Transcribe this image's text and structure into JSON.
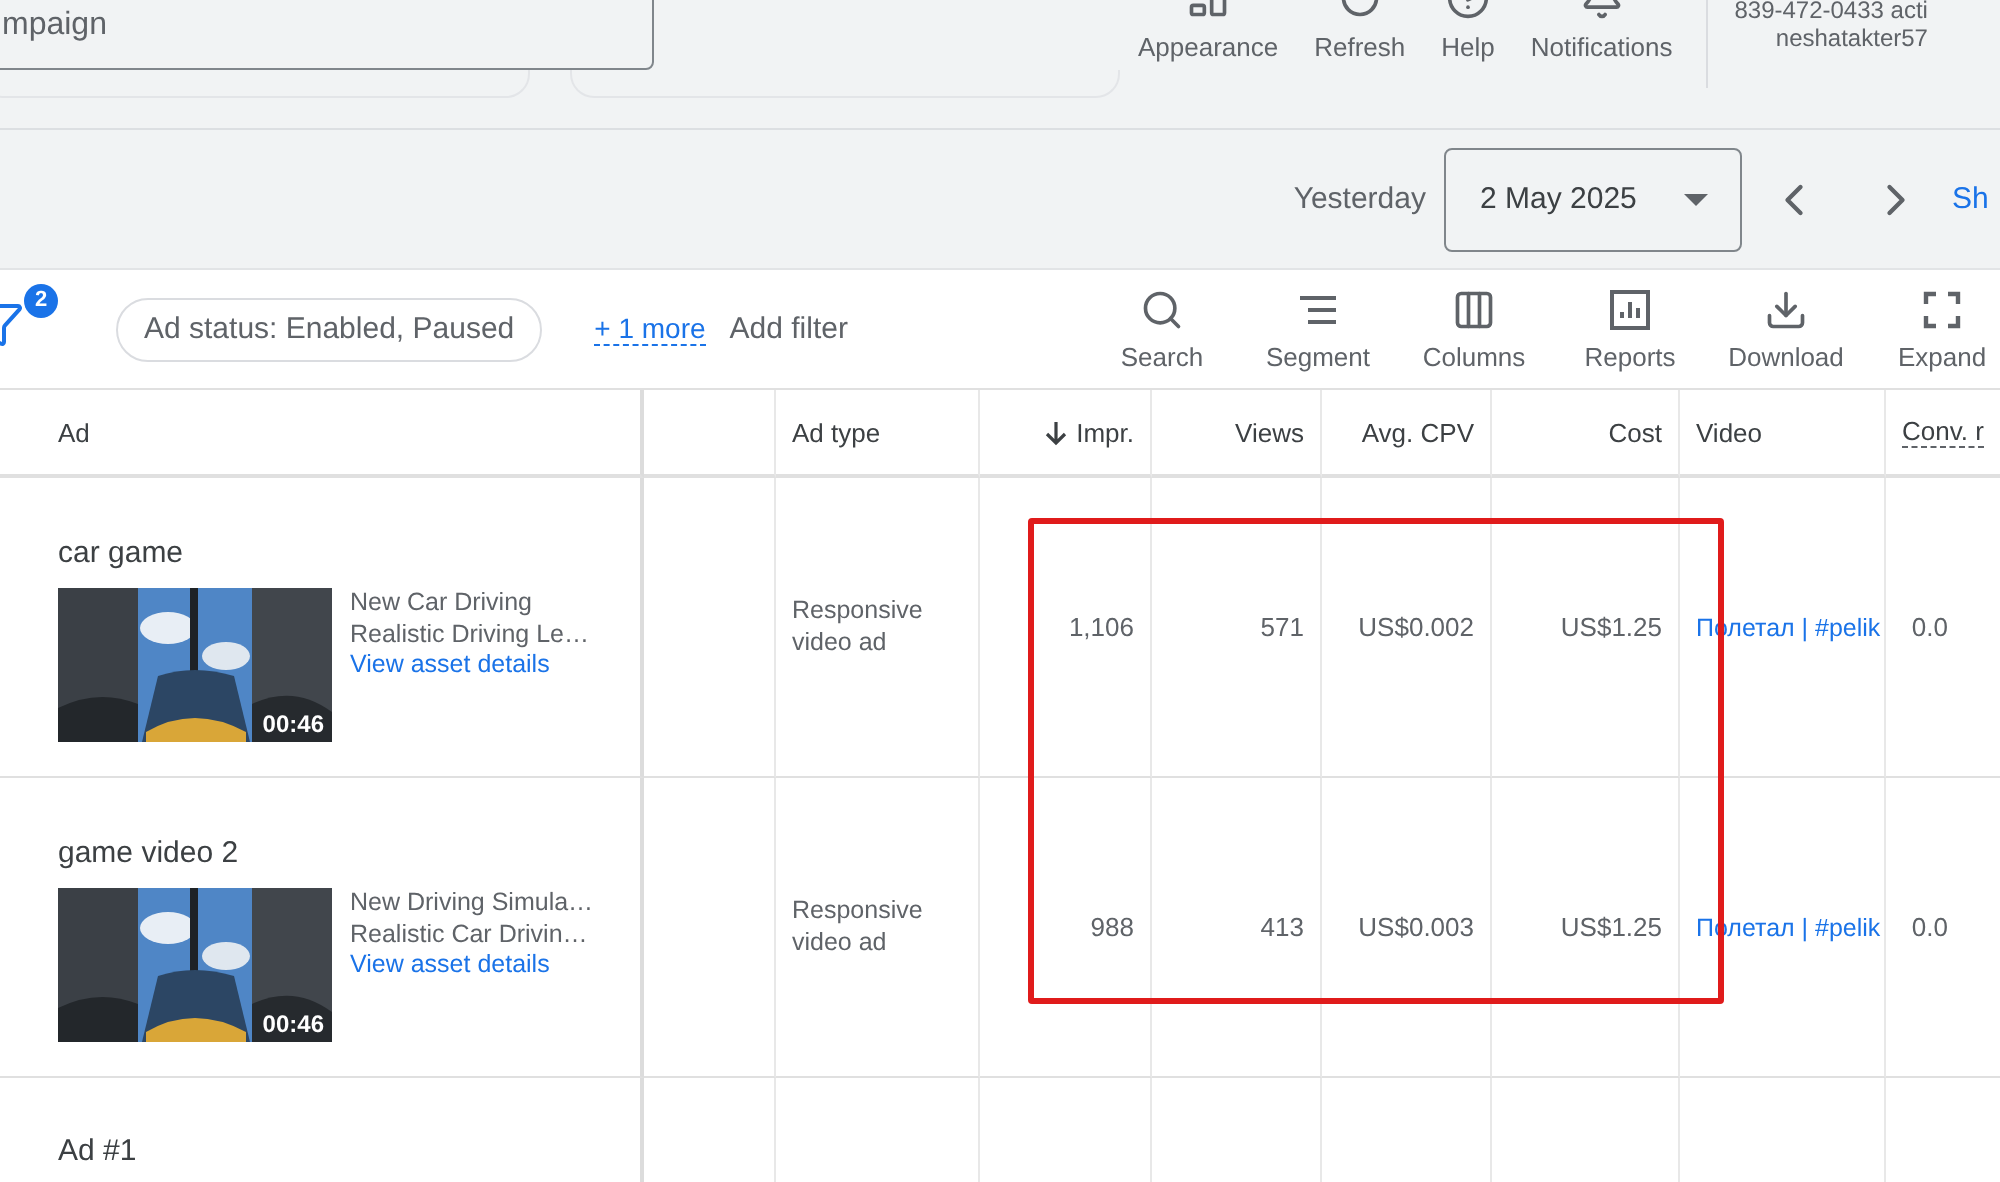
{
  "header": {
    "search_value": "mpaign",
    "tools": [
      {
        "kind": "appearance",
        "label": "Appearance"
      },
      {
        "kind": "refresh",
        "label": "Refresh"
      },
      {
        "kind": "help",
        "label": "Help"
      },
      {
        "kind": "notifications",
        "label": "Notifications"
      }
    ],
    "account": {
      "phone": "839-472-0433 acti",
      "email": "neshatakter57"
    }
  },
  "date_bar": {
    "label": "Yesterday",
    "date": "2 May 2025",
    "link": "Sh"
  },
  "filter_bar": {
    "filter_count": "2",
    "chip": "Ad status: Enabled, Paused",
    "more_link": "+ 1 more",
    "add_filter": "Add filter",
    "tools": [
      {
        "kind": "search",
        "label": "Search"
      },
      {
        "kind": "segment",
        "label": "Segment"
      },
      {
        "kind": "columns",
        "label": "Columns"
      },
      {
        "kind": "reports",
        "label": "Reports"
      },
      {
        "kind": "download",
        "label": "Download"
      },
      {
        "kind": "expand",
        "label": "Expand"
      }
    ]
  },
  "table": {
    "columns": [
      {
        "label": "Ad",
        "kind": "text",
        "sorted": false
      },
      {
        "label": "Ad type",
        "kind": "text",
        "sorted": false
      },
      {
        "label": "Impr.",
        "kind": "number",
        "sorted": true
      },
      {
        "label": "Views",
        "kind": "number",
        "sorted": false
      },
      {
        "label": "Avg. CPV",
        "kind": "number",
        "sorted": false
      },
      {
        "label": "Cost",
        "kind": "number",
        "sorted": false
      },
      {
        "label": "Video",
        "kind": "text",
        "sorted": false
      },
      {
        "label": "Conv. r",
        "kind": "glossary",
        "sorted": false
      }
    ],
    "rows": [
      {
        "name": "car game",
        "video": {
          "kind": "picture",
          "duration": "00:46",
          "title_lines": [
            "New Car Driving",
            "Realistic Driving Le…"
          ],
          "link": "View asset details"
        },
        "ad_type": "Responsive video ad",
        "impr": "1,106",
        "views": "571",
        "avg_cpv": "US$0.002",
        "cost": "US$1.25",
        "video_link": "Полетал | #pelik",
        "conv": "0.0"
      },
      {
        "name": "game video 2",
        "video": {
          "kind": "picture",
          "duration": "00:46",
          "title_lines": [
            "New Driving Simula…",
            "Realistic Car Drivin…"
          ],
          "link": "View asset details"
        },
        "ad_type": "Responsive video ad",
        "impr": "988",
        "views": "413",
        "avg_cpv": "US$0.003",
        "cost": "US$1.25",
        "video_link": "Полетал | #pelik",
        "conv": "0.0"
      },
      {
        "name": "Ad #1"
      }
    ]
  },
  "annotation": {
    "kind": "highlight-box"
  }
}
